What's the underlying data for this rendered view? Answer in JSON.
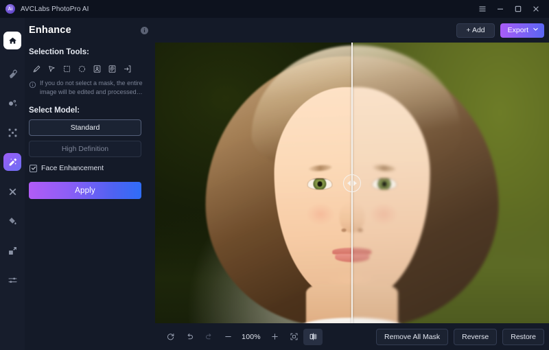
{
  "titlebar": {
    "app_name": "AVCLabs PhotoPro AI",
    "logo_text": "Ai",
    "menu_icon": "hamburger-menu-icon",
    "minimize_icon": "minimize-icon",
    "maximize_icon": "maximize-icon",
    "close_icon": "close-icon"
  },
  "rail": {
    "home_icon": "home-icon",
    "items": [
      {
        "icon": "eraser-icon",
        "name": "sidebar-item-erase",
        "active": false
      },
      {
        "icon": "background-remove-icon",
        "name": "sidebar-item-background",
        "active": false
      },
      {
        "icon": "expand-pixels-icon",
        "name": "sidebar-item-pixelate",
        "active": false
      },
      {
        "icon": "enhance-magic-icon",
        "name": "sidebar-item-enhance",
        "active": true
      },
      {
        "icon": "retouch-icon",
        "name": "sidebar-item-retouch",
        "active": false
      },
      {
        "icon": "color-fill-icon",
        "name": "sidebar-item-colorize",
        "active": false
      },
      {
        "icon": "resize-icon",
        "name": "sidebar-item-resize",
        "active": false
      },
      {
        "icon": "adjust-sliders-icon",
        "name": "sidebar-item-adjust",
        "active": false
      }
    ]
  },
  "panel": {
    "title": "Enhance",
    "info_icon": "info-icon",
    "info_glyph": "i",
    "selection_tools_label": "Selection Tools:",
    "tools": [
      {
        "icon": "brush-icon",
        "name": "tool-brush"
      },
      {
        "icon": "lasso-pointer-icon",
        "name": "tool-lasso"
      },
      {
        "icon": "rectangle-select-icon",
        "name": "tool-rectangle"
      },
      {
        "icon": "ellipse-select-icon",
        "name": "tool-ellipse"
      },
      {
        "icon": "portrait-select-icon",
        "name": "tool-portrait"
      },
      {
        "icon": "mask-pattern-icon",
        "name": "tool-mask"
      },
      {
        "icon": "arrow-into-box-icon",
        "name": "tool-import-mask"
      }
    ],
    "hint_icon": "info-circle-icon",
    "hint_text": "If you do not select a mask, the entire image will be edited and processed…",
    "select_model_label": "Select Model:",
    "models": [
      {
        "label": "Standard",
        "selected": true
      },
      {
        "label": "High Definition",
        "selected": false
      }
    ],
    "face_enhancement_label": "Face Enhancement",
    "face_enhancement_checked": true,
    "check_glyph": "✓",
    "apply_label": "Apply"
  },
  "stage": {
    "add_label": "+ Add",
    "add_icon": "plus-icon",
    "export_label": "Export",
    "export_chevron_icon": "chevron-down-icon",
    "compare_handle_icon": "compare-slider-handle-icon",
    "left_arrow_icon": "arrow-left-icon",
    "right_arrow_icon": "arrow-right-icon"
  },
  "bottombar": {
    "reset_icon": "reset-rotate-icon",
    "undo_icon": "undo-icon",
    "redo_icon": "redo-icon",
    "zoom_out_icon": "minus-icon",
    "zoom_level": "100%",
    "zoom_in_icon": "plus-icon",
    "fit_screen_icon": "fit-to-screen-icon",
    "compare_icon": "compare-split-icon",
    "compare_active": true,
    "remove_all_mask_label": "Remove All Mask",
    "reverse_label": "Reverse",
    "restore_label": "Restore"
  },
  "colors": {
    "window_bg": "#141a28",
    "titlebar_bg": "#0d121e",
    "rail_bg": "#171d2c",
    "accent_purple": "#a95cf6",
    "accent_blue": "#5a66f3",
    "text_primary": "#e6e9f1",
    "text_muted": "#7b8396"
  }
}
